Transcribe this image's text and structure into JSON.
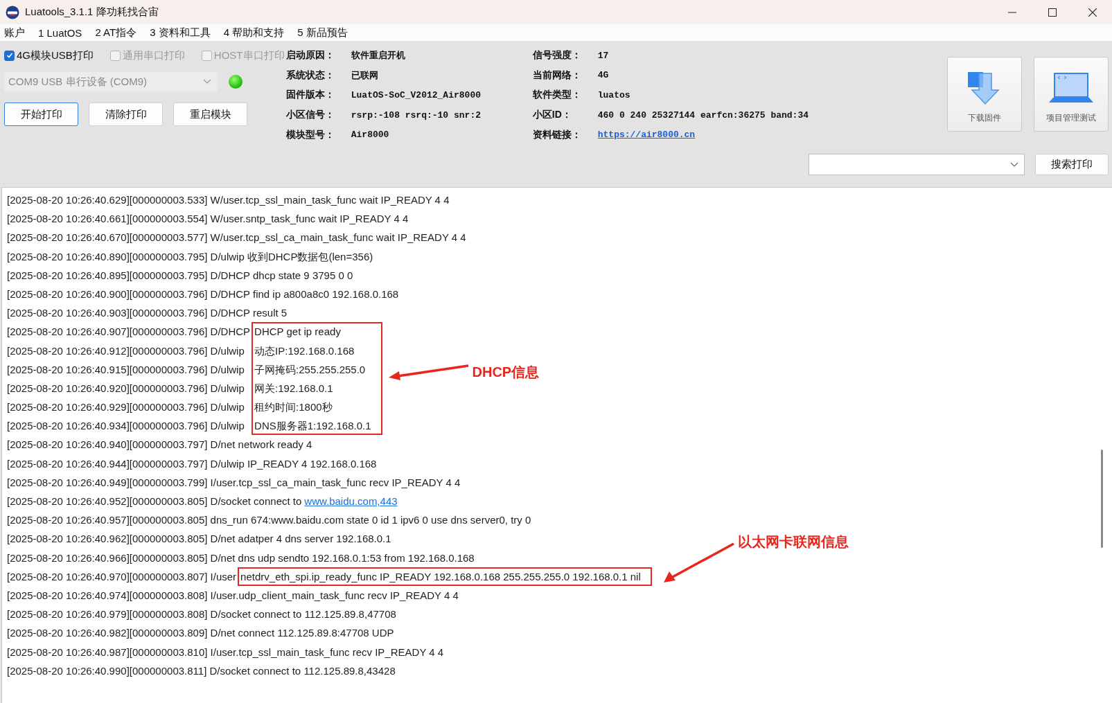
{
  "window": {
    "title": "Luatools_3.1.1 降功耗找合宙"
  },
  "menu": [
    "账户",
    "1 LuatOS",
    "2 AT指令",
    "3 资料和工具",
    "4 帮助和支持",
    "5 新品预告"
  ],
  "print_sources": [
    {
      "label": "4G模块USB打印",
      "checked": true,
      "disabled": false
    },
    {
      "label": "通用串口打印",
      "checked": false,
      "disabled": true
    },
    {
      "label": "HOST串口打印",
      "checked": false,
      "disabled": true
    }
  ],
  "port": {
    "value": "COM9 USB 串行设备 (COM9)",
    "connected": true
  },
  "buttons": [
    {
      "label": "开始打印",
      "focused": true
    },
    {
      "label": "清除打印",
      "focused": false
    },
    {
      "label": "重启模块",
      "focused": false
    }
  ],
  "info_columns": [
    [
      {
        "label": "启动原因：",
        "value": "软件重启开机",
        "kind": "text"
      },
      {
        "label": "系统状态：",
        "value": "已联网",
        "kind": "text"
      },
      {
        "label": "固件版本：",
        "value": "LuatOS-SoC_V2012_Air8000",
        "kind": "text"
      },
      {
        "label": "小区信号：",
        "value": "rsrp:-108 rsrq:-10 snr:2",
        "kind": "text"
      },
      {
        "label": "模块型号：",
        "value": "Air8000",
        "kind": "text"
      }
    ],
    [
      {
        "label": "信号强度：",
        "value": "17",
        "kind": "text"
      },
      {
        "label": "当前网络：",
        "value": "4G",
        "kind": "text"
      },
      {
        "label": "软件类型：",
        "value": "luatos",
        "kind": "text"
      },
      {
        "label": "小区ID：",
        "value": "460 0 240 25327144 earfcn:36275 band:34",
        "kind": "text"
      },
      {
        "label": "资料链接：",
        "value": "https://air8000.cn",
        "kind": "link"
      }
    ]
  ],
  "tools": [
    {
      "label": "下载固件",
      "kind": "download"
    },
    {
      "label": "项目管理测试",
      "kind": "laptop"
    }
  ],
  "search": {
    "button": "搜索打印"
  },
  "log": {
    "entries": [
      {
        "kind": "line",
        "text": "[2025-08-20 10:26:40.629][000000003.533] W/user.tcp_ssl_main_task_func wait IP_READY 4 4"
      },
      {
        "kind": "line",
        "text": "[2025-08-20 10:26:40.661][000000003.554] W/user.sntp_task_func wait IP_READY 4 4"
      },
      {
        "kind": "line",
        "text": "[2025-08-20 10:26:40.670][000000003.577] W/user.tcp_ssl_ca_main_task_func wait IP_READY 4 4"
      },
      {
        "kind": "line",
        "text": "[2025-08-20 10:26:40.890][000000003.795] D/ulwip 收到DHCP数据包(len=356)"
      },
      {
        "kind": "line",
        "text": "[2025-08-20 10:26:40.895][000000003.795] D/DHCP dhcp state 9 3795 0 0"
      },
      {
        "kind": "line",
        "text": "[2025-08-20 10:26:40.900][000000003.796] D/DHCP find ip a800a8c0 192.168.0.168"
      },
      {
        "kind": "line",
        "text": "[2025-08-20 10:26:40.903][000000003.796] D/DHCP result 5"
      },
      {
        "kind": "boxed",
        "callout": {
          "label": "DHCP信息"
        },
        "rows": [
          {
            "prefix": "[2025-08-20 10:26:40.907][000000003.796] D/DHCP",
            "message": "DHCP get ip ready"
          },
          {
            "prefix": "[2025-08-20 10:26:40.912][000000003.796] D/ulwip",
            "message": "动态IP:192.168.0.168"
          },
          {
            "prefix": "[2025-08-20 10:26:40.915][000000003.796] D/ulwip",
            "message": "子网掩码:255.255.255.0"
          },
          {
            "prefix": "[2025-08-20 10:26:40.920][000000003.796] D/ulwip",
            "message": "网关:192.168.0.1"
          },
          {
            "prefix": "[2025-08-20 10:26:40.929][000000003.796] D/ulwip",
            "message": "租约时间:1800秒"
          },
          {
            "prefix": "[2025-08-20 10:26:40.934][000000003.796] D/ulwip",
            "message": "DNS服务器1:192.168.0.1"
          }
        ]
      },
      {
        "kind": "line",
        "text": "[2025-08-20 10:26:40.940][000000003.797] D/net network ready 4"
      },
      {
        "kind": "line",
        "text": "[2025-08-20 10:26:40.944][000000003.797] D/ulwip IP_READY 4 192.168.0.168"
      },
      {
        "kind": "line",
        "text": "[2025-08-20 10:26:40.949][000000003.799] I/user.tcp_ssl_ca_main_task_func recv IP_READY 4 4"
      },
      {
        "kind": "line",
        "text": "[2025-08-20 10:26:40.952][000000003.805] D/socket connect to",
        "link": "www.baidu.com,443"
      },
      {
        "kind": "line",
        "text": "[2025-08-20 10:26:40.957][000000003.805] dns_run 674:www.baidu.com state 0 id 1 ipv6 0 use dns server0, try 0"
      },
      {
        "kind": "line",
        "text": "[2025-08-20 10:26:40.962][000000003.805] D/net adatper 4 dns server 192.168.0.1"
      },
      {
        "kind": "line",
        "text": "[2025-08-20 10:26:40.966][000000003.805] D/net dns udp sendto 192.168.0.1:53 from 192.168.0.168"
      },
      {
        "kind": "boxed",
        "callout": {
          "label": "以太网卡联网信息"
        },
        "rows": [
          {
            "prefix": "[2025-08-20 10:26:40.970][000000003.807] I/user",
            "message": "netdrv_eth_spi.ip_ready_func IP_READY 192.168.0.168 255.255.255.0 192.168.0.1 nil"
          }
        ]
      },
      {
        "kind": "line",
        "text": "[2025-08-20 10:26:40.974][000000003.808] I/user.udp_client_main_task_func recv IP_READY 4 4"
      },
      {
        "kind": "line",
        "text": "[2025-08-20 10:26:40.979][000000003.808] D/socket connect to 112.125.89.8,47708"
      },
      {
        "kind": "line",
        "text": "[2025-08-20 10:26:40.982][000000003.809] D/net connect 112.125.89.8:47708 UDP"
      },
      {
        "kind": "line",
        "text": "[2025-08-20 10:26:40.987][000000003.810] I/user.tcp_ssl_main_task_func recv IP_READY 4 4"
      },
      {
        "kind": "line",
        "text": "[2025-08-20 10:26:40.990][000000003.811] D/socket connect to 112.125.89.8,43428"
      }
    ]
  }
}
